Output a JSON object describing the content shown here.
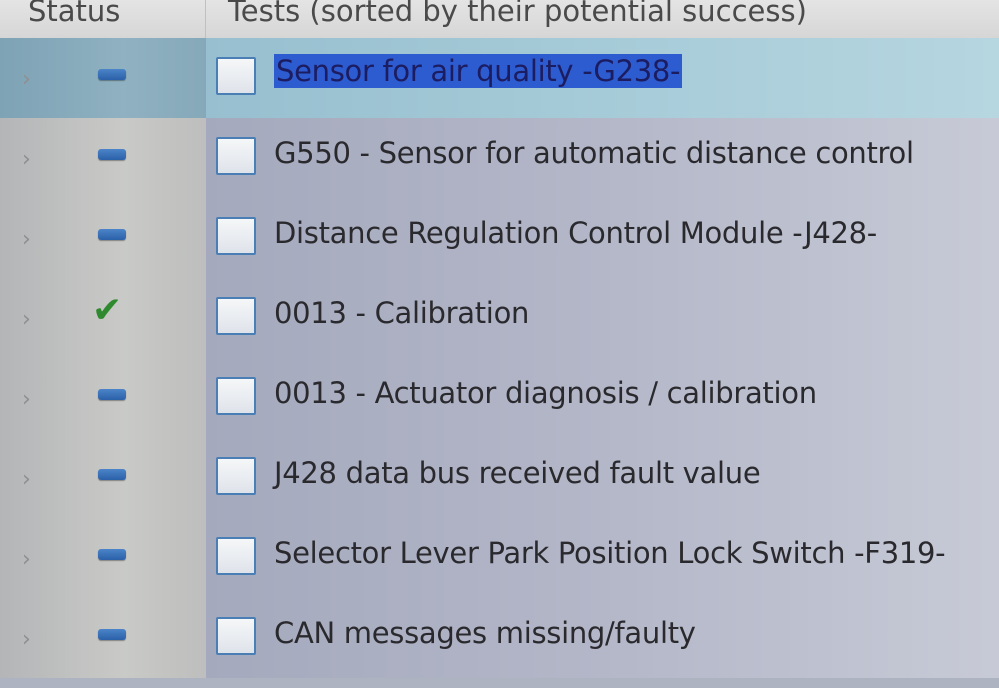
{
  "header": {
    "status": "Status",
    "tests": "Tests (sorted by their potential success)"
  },
  "rows": [
    {
      "label": "Sensor for air quality -G238-",
      "status": "dash",
      "selected": true
    },
    {
      "label": "G550 - Sensor for automatic distance control",
      "status": "dash",
      "selected": false
    },
    {
      "label": "Distance Regulation Control Module -J428-",
      "status": "dash",
      "selected": false
    },
    {
      "label": "0013 - Calibration",
      "status": "check",
      "selected": false
    },
    {
      "label": "0013 - Actuator diagnosis / calibration",
      "status": "dash",
      "selected": false
    },
    {
      "label": "J428 data bus received fault value",
      "status": "dash",
      "selected": false
    },
    {
      "label": "Selector Lever Park Position Lock Switch -F319-",
      "status": "dash",
      "selected": false
    },
    {
      "label": "CAN messages missing/faulty",
      "status": "dash",
      "selected": false
    }
  ],
  "icons": {
    "expand": "chevron-right-icon",
    "status_pending": "blue-dash-icon",
    "status_ok": "green-check-icon",
    "test": "checkbox-icon"
  },
  "colors": {
    "selection": "#2d5bd0",
    "status_pending": "#3a72bb",
    "status_ok": "#2f8a2f"
  }
}
